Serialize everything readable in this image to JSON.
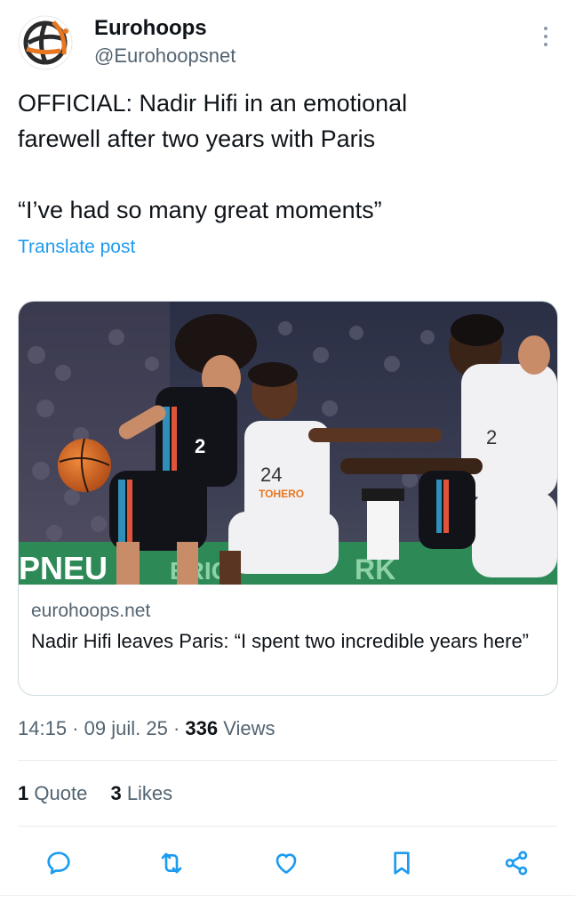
{
  "author": {
    "name": "Eurohoops",
    "handle": "@Eurohoopsnet"
  },
  "post": {
    "line1": "OFFICIAL: Nadir Hifi in an emotional",
    "line2": "farewell after two years with Paris",
    "line3": "“I’ve had so many great moments”",
    "translate_label": "Translate post"
  },
  "card": {
    "image_texts": {
      "jersey_2": "2",
      "jersey_24": "24",
      "sponsor": "TOHERO",
      "banner_left": "PNEU",
      "banner_mid": "ERIC",
      "banner_right": "RK"
    },
    "domain": "eurohoops.net",
    "title": "Nadir Hifi leaves Paris: “I spent two incredible years here”"
  },
  "meta": {
    "time": "14:15",
    "date": "09 juil. 25",
    "views_count": "336",
    "views_label": "Views",
    "sep": "·"
  },
  "stats": {
    "quotes_count": "1",
    "quotes_label": "Quote",
    "likes_count": "3",
    "likes_label": "Likes"
  },
  "actions": [
    {
      "name": "reply-icon"
    },
    {
      "name": "retweet-icon"
    },
    {
      "name": "like-icon"
    },
    {
      "name": "bookmark-icon"
    },
    {
      "name": "share-icon"
    }
  ],
  "colors": {
    "accent": "#1d9bf0",
    "text": "#0f1419",
    "muted": "#536471",
    "border": "#cfd9de"
  }
}
